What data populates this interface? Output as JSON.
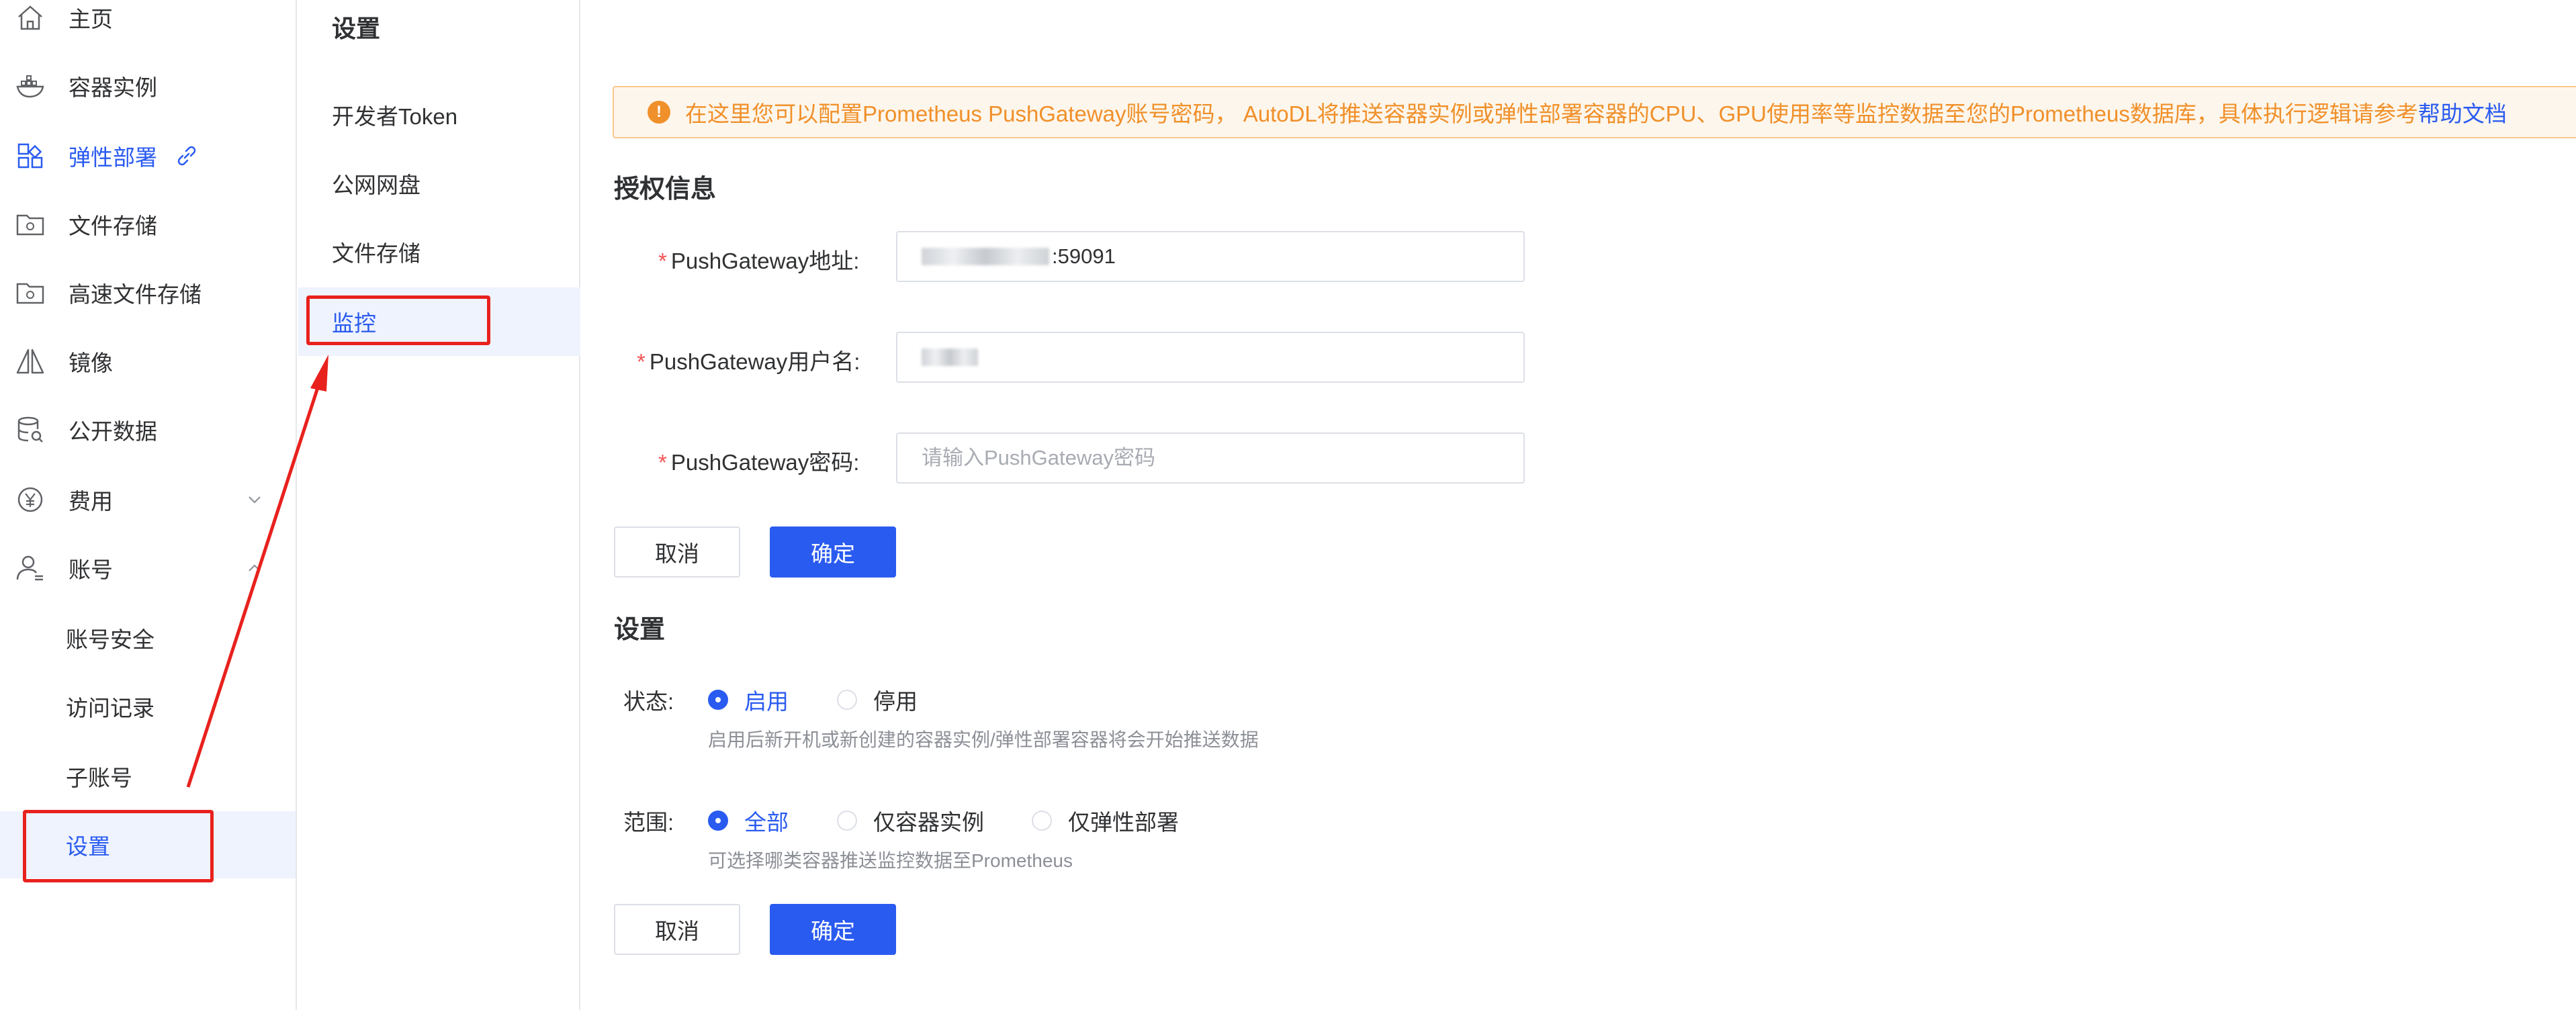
{
  "sidebar": {
    "items": [
      {
        "label": "主页",
        "icon": "home-icon"
      },
      {
        "label": "容器实例",
        "icon": "container-icon"
      },
      {
        "label": "弹性部署",
        "icon": "apps-grid-icon",
        "extra_icon": "link-icon"
      },
      {
        "label": "文件存储",
        "icon": "storage-icon"
      },
      {
        "label": "高速文件存储",
        "icon": "storage-icon"
      },
      {
        "label": "镜像",
        "icon": "mirror-icon"
      },
      {
        "label": "公开数据",
        "icon": "database-icon"
      },
      {
        "label": "费用",
        "icon": "yen-icon"
      },
      {
        "label": "账号",
        "icon": "user-icon"
      }
    ],
    "account_sub": [
      "账号安全",
      "访问记录",
      "子账号",
      "设置"
    ]
  },
  "submenu": {
    "title": "设置",
    "items": [
      "开发者Token",
      "公网网盘",
      "文件存储",
      "监控"
    ]
  },
  "notice": {
    "text": "在这里您可以配置Prometheus PushGateway账号密码， AutoDL将推送容器实例或弹性部署容器的CPU、GPU使用率等监控数据至您的Prometheus数据库，具体执行逻辑请参考",
    "link": "帮助文档"
  },
  "auth": {
    "title": "授权信息",
    "address_label": "PushGateway地址:",
    "address_value_visible": ":59091",
    "username_label": "PushGateway用户名:",
    "password_label": "PushGateway密码:",
    "password_placeholder": "请输入PushGateway密码",
    "cancel": "取消",
    "confirm": "确定"
  },
  "settings": {
    "title": "设置",
    "status_label": "状态:",
    "status_options": [
      "启用",
      "停用"
    ],
    "status_selected": "启用",
    "status_hint": "启用后新开机或新创建的容器实例/弹性部署容器将会开始推送数据",
    "scope_label": "范围:",
    "scope_options": [
      "全部",
      "仅容器实例",
      "仅弹性部署"
    ],
    "scope_selected": "全部",
    "scope_hint": "可选择哪类容器推送监控数据至Prometheus",
    "cancel": "取消",
    "confirm": "确定"
  },
  "colors": {
    "primary": "#2a5bf0",
    "warning": "#f0902a",
    "annotation": "#e8211d",
    "required": "#f25454"
  }
}
